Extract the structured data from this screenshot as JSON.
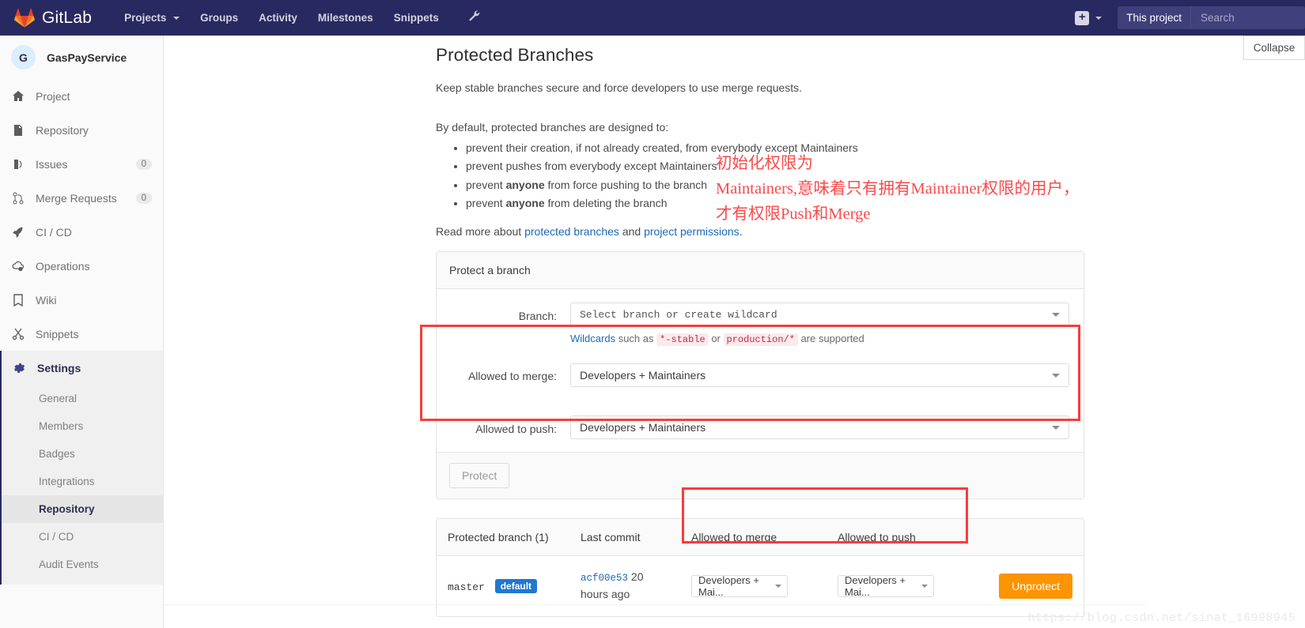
{
  "navbar": {
    "brand": "GitLab",
    "links": [
      {
        "label": "Projects",
        "has_caret": true
      },
      {
        "label": "Groups",
        "has_caret": false
      },
      {
        "label": "Activity",
        "has_caret": false
      },
      {
        "label": "Milestones",
        "has_caret": false
      },
      {
        "label": "Snippets",
        "has_caret": false
      }
    ],
    "wrench_icon": "wrench-icon",
    "plus_label": "+",
    "scope_label": "This project",
    "search_placeholder": "Search"
  },
  "sidebar": {
    "project_initial": "G",
    "project_name": "GasPayService",
    "items": [
      {
        "label": "Project",
        "icon": "home-icon",
        "count": ""
      },
      {
        "label": "Repository",
        "icon": "document-icon",
        "count": ""
      },
      {
        "label": "Issues",
        "icon": "issues-icon",
        "count": "0"
      },
      {
        "label": "Merge Requests",
        "icon": "merge-request-icon",
        "count": "0"
      },
      {
        "label": "CI / CD",
        "icon": "rocket-icon",
        "count": ""
      },
      {
        "label": "Operations",
        "icon": "cloud-gear-icon",
        "count": ""
      },
      {
        "label": "Wiki",
        "icon": "book-icon",
        "count": ""
      },
      {
        "label": "Snippets",
        "icon": "scissors-icon",
        "count": ""
      }
    ],
    "settings": {
      "label": "Settings",
      "icon": "gear-icon"
    },
    "settings_items": [
      {
        "label": "General",
        "active": false
      },
      {
        "label": "Members",
        "active": false
      },
      {
        "label": "Badges",
        "active": false
      },
      {
        "label": "Integrations",
        "active": false
      },
      {
        "label": "Repository",
        "active": true
      },
      {
        "label": "CI / CD",
        "active": false
      },
      {
        "label": "Audit Events",
        "active": false
      }
    ]
  },
  "collapse_label": "Collapse",
  "main": {
    "title": "Protected Branches",
    "subtitle": "Keep stable branches secure and force developers to use merge requests.",
    "intro": "By default, protected branches are designed to:",
    "rules": [
      {
        "pre": "prevent their creation, if not already created, from everybody except Maintainers",
        "bold": "",
        "post": ""
      },
      {
        "pre": "prevent pushes from everybody except Maintainers",
        "bold": "",
        "post": ""
      },
      {
        "pre": "prevent ",
        "bold": "anyone",
        "post": " from force pushing to the branch"
      },
      {
        "pre": "prevent ",
        "bold": "anyone",
        "post": " from deleting the branch"
      }
    ],
    "readmore": {
      "prefix": "Read more about ",
      "link1": "protected branches",
      "mid": " and ",
      "link2": "project permissions",
      "suffix": "."
    }
  },
  "form": {
    "heading": "Protect a branch",
    "branch_label": "Branch:",
    "branch_value": "Select branch or create wildcard",
    "helper": {
      "prefix": "Wildcards",
      "mid1": " such as ",
      "code1": "*-stable",
      "mid2": " or ",
      "code2": "production/*",
      "suffix": " are supported"
    },
    "merge_label": "Allowed to merge:",
    "merge_value": "Developers + Maintainers",
    "push_label": "Allowed to push:",
    "push_value": "Developers + Maintainers",
    "protect_button": "Protect"
  },
  "table": {
    "headers": [
      "Protected branch (1)",
      "Last commit",
      "Allowed to merge",
      "Allowed to push",
      ""
    ],
    "rows": [
      {
        "branch": "master",
        "badge": "default",
        "commit_sha": "acf00e53",
        "commit_time": "20 hours ago",
        "merge": "Developers + Mai...",
        "push": "Developers + Mai...",
        "action": "Unprotect"
      }
    ]
  },
  "annotations": {
    "line1": "初始化权限为",
    "line2": "Maintainers,意味着只有拥有Maintainer权限的用户，",
    "line3": "才有权限Push和Merge"
  },
  "watermark": "https://blog.csdn.net/sinat_16998945",
  "colors": {
    "navbar": "#292961",
    "accent_link": "#1b69b6",
    "unprotect": "#fc9403",
    "badge": "#1f78d1",
    "annotation": "#fb4a4a"
  }
}
